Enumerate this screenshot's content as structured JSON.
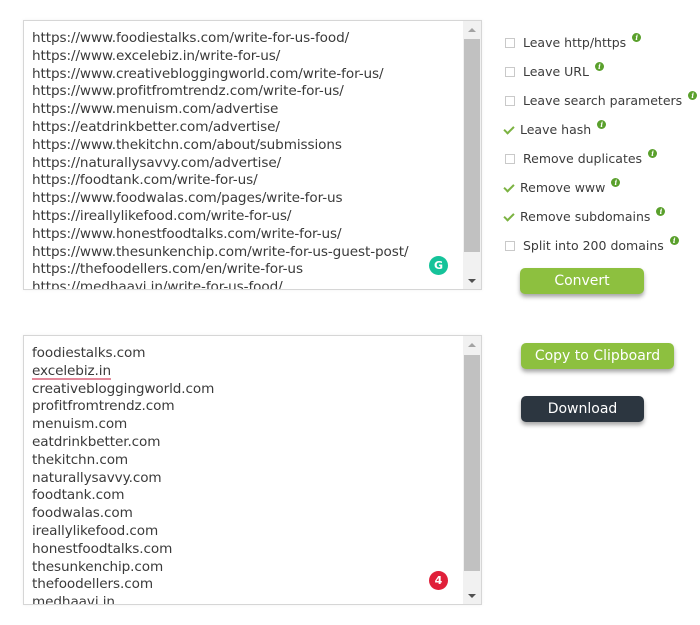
{
  "input": {
    "lines": [
      "https://www.foodiestalks.com/write-for-us-food/",
      "https://www.excelebiz.in/write-for-us/",
      "https://www.creativebloggingworld.com/write-for-us/",
      "https://www.profitfromtrendz.com/write-for-us/",
      "https://www.menuism.com/advertise",
      "https://eatdrinkbetter.com/advertise/",
      "https://www.thekitchn.com/about/submissions",
      "https://naturallysavvy.com/advertise/",
      "https://foodtank.com/write-for-us/",
      "https://www.foodwalas.com/pages/write-for-us",
      "https://ireallylikefood.com/write-for-us/",
      "https://www.honestfoodtalks.com/write-for-us/",
      "https://www.thesunkenchip.com/write-for-us-guest-post/",
      "https://thefoodellers.com/en/write-for-us",
      "https://medhaavi.in/write-for-us-food/"
    ],
    "grammarly_icon": "G"
  },
  "options": [
    {
      "label": "Leave http/https",
      "checked": false
    },
    {
      "label": "Leave URL",
      "checked": false
    },
    {
      "label": "Leave search parameters",
      "checked": false
    },
    {
      "label": "Leave hash",
      "checked": true
    },
    {
      "label": "Remove duplicates",
      "checked": false
    },
    {
      "label": "Remove www",
      "checked": true
    },
    {
      "label": "Remove subdomains",
      "checked": true
    },
    {
      "label": "Split into 200 domains",
      "checked": false
    }
  ],
  "info_glyph": "i",
  "buttons": {
    "convert": "Convert",
    "copy": "Copy to Clipboard",
    "download": "Download"
  },
  "output": {
    "lines": [
      "foodiestalks.com",
      "excelebiz.in",
      "creativebloggingworld.com",
      "profitfromtrendz.com",
      "menuism.com",
      "eatdrinkbetter.com",
      "thekitchn.com",
      "naturallysavvy.com",
      "foodtank.com",
      "foodwalas.com",
      "ireallylikefood.com",
      "honestfoodtalks.com",
      "thesunkenchip.com",
      "thefoodellers.com",
      "medhaavi.in"
    ],
    "misspelled_index": 1,
    "grammarly_count": "4"
  },
  "colors": {
    "accent_green": "#8dc03f",
    "dark_button": "#2c3640",
    "grammarly_green": "#15c39a",
    "grammarly_red": "#e0203a"
  }
}
